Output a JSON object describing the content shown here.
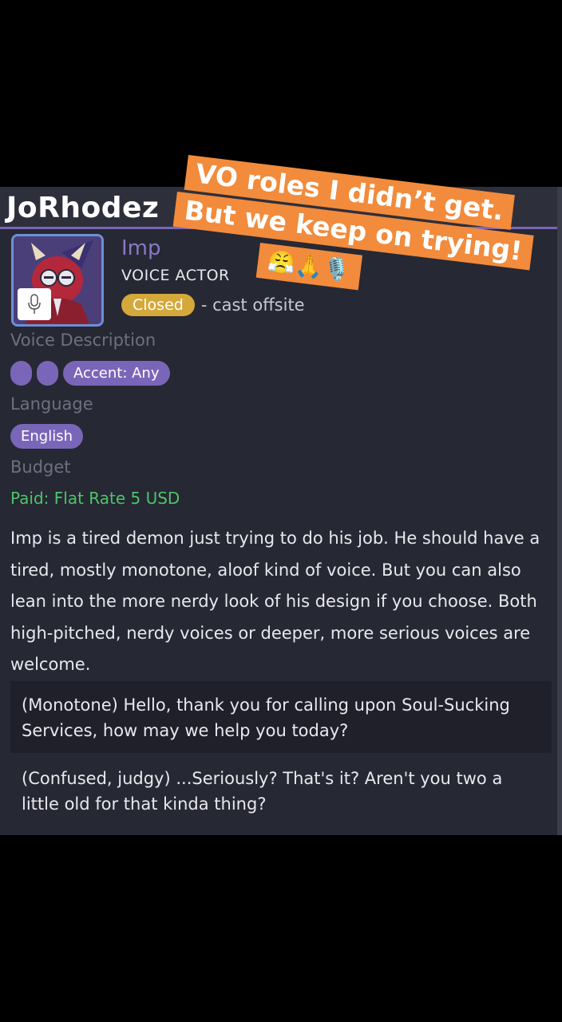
{
  "header": {
    "username": "JoRhodez"
  },
  "role": {
    "name": "Imp",
    "type": "VOICE ACTOR",
    "status": "Closed",
    "status_note": "- cast offsite"
  },
  "labels": {
    "voice_description": "Voice Description",
    "language": "Language",
    "budget": "Budget"
  },
  "tags": {
    "accent": "Accent: Any",
    "language": "English"
  },
  "budget": {
    "text": "Paid: Flat Rate 5 USD"
  },
  "description": "Imp is a tired demon just trying to do his job. He should have a tired, mostly monotone, aloof kind of voice. But you can also lean into the more nerdy look of his design if you choose. Both high-pitched, nerdy voices or deeper, more serious voices are welcome.",
  "lines": [
    "(Monotone) Hello, thank you for calling upon Soul-Sucking Services, how may we help you today?",
    "(Confused, judgy) ...Seriously? That's it? Aren't you two a little old for that kinda thing?"
  ],
  "overlay": {
    "line1": "VO roles I didn’t get.",
    "line2": "But we keep on trying!",
    "emojis": "😤🙏🎙️"
  },
  "colors": {
    "accent_purple": "#7a66b8",
    "closed_yellow": "#d4a83a",
    "budget_green": "#4ec46a",
    "overlay_orange": "#f28b3c",
    "card_bg": "#262833"
  }
}
